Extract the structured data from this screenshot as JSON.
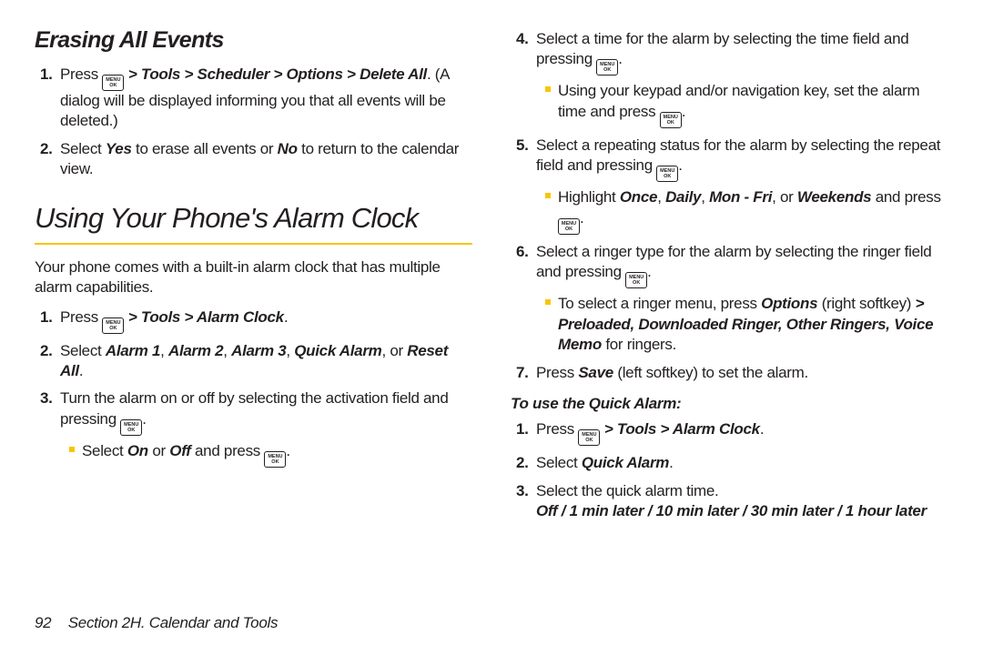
{
  "left": {
    "h_erase": "Erasing All Events",
    "erase_steps": [
      {
        "pre": "Press ",
        "path": " > Tools > Scheduler > Options > Delete All",
        "post": ". (A dialog will be displayed informing you that all events will be deleted.)"
      },
      {
        "text_a": "Select ",
        "yes": "Yes",
        "text_b": " to erase all events or ",
        "no": "No",
        "text_c": " to return to the calendar view."
      }
    ],
    "h_alarm": "Using Your Phone's Alarm Clock",
    "intro": "Your phone comes with a built-in alarm clock that has multiple alarm capabilities.",
    "alarm_steps": {
      "s1_pre": "Press ",
      "s1_path": " > Tools > Alarm Clock",
      "s1_post": ".",
      "s2_a": "Select ",
      "s2_b": "Alarm 1",
      "s2_c": ", ",
      "s2_d": "Alarm 2",
      "s2_e": ", ",
      "s2_f": "Alarm 3",
      "s2_g": ", ",
      "s2_h": "Quick Alarm",
      "s2_i": ", or ",
      "s2_j": "Reset All",
      "s2_k": ".",
      "s3_a": "Turn the alarm on or off by selecting the activation field and pressing ",
      "s3_b": ".",
      "s3sub_a": "Select ",
      "s3sub_b": "On",
      "s3sub_c": " or ",
      "s3sub_d": "Off",
      "s3sub_e": " and press ",
      "s3sub_f": "."
    }
  },
  "right": {
    "s4_a": "Select a time for the alarm by selecting the time field and pressing ",
    "s4_b": ".",
    "s4sub_a": "Using your keypad and/or navigation key, set the alarm time and press ",
    "s4sub_b": ".",
    "s5_a": "Select a repeating status for the alarm by selecting the repeat field and pressing ",
    "s5_b": ".",
    "s5sub_a": "Highlight ",
    "s5sub_b": "Once",
    "s5sub_c": ", ",
    "s5sub_d": "Daily",
    "s5sub_e": ", ",
    "s5sub_f": "Mon - Fri",
    "s5sub_g": ", or ",
    "s5sub_h": "Weekends",
    "s5sub_i": " and press ",
    "s5sub_j": ".",
    "s6_a": "Select a ringer type for the alarm by selecting the ringer field and pressing ",
    "s6_b": ".",
    "s6sub_a": "To select a ringer menu, press ",
    "s6sub_b": "Options",
    "s6sub_c": " (right softkey) ",
    "s6sub_d": "> Preloaded, Downloaded Ringer, Other Ringers, Voice Memo",
    "s6sub_e": " for ringers.",
    "s7_a": "Press ",
    "s7_b": "Save",
    "s7_c": " (left softkey) to set the alarm.",
    "quick_h": "To use the Quick Alarm:",
    "q1_pre": "Press ",
    "q1_path": " > Tools > Alarm Clock",
    "q1_post": ".",
    "q2_a": "Select ",
    "q2_b": "Quick Alarm",
    "q2_c": ".",
    "q3_a": "Select the quick alarm time.",
    "q3_b": "Off / 1 min later / 10 min later / 30 min later / 1 hour later"
  },
  "footer": {
    "page": "92",
    "section": "Section 2H. Calendar and Tools"
  },
  "menuok": {
    "top": "MENU",
    "bottom": "OK"
  }
}
